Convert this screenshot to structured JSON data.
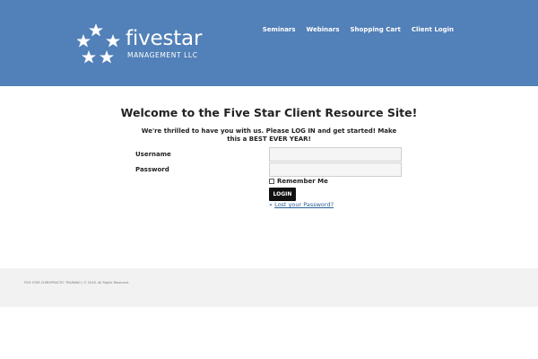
{
  "brand": {
    "name": "fivestar",
    "subtitle": "MANAGEMENT LLC",
    "star_color": "#ffffff"
  },
  "colors": {
    "header_bg": "#5280b8",
    "footer_bg": "#f2f2f2",
    "button_bg": "#111111",
    "link": "#2a5f97"
  },
  "nav": {
    "items": [
      {
        "label": "Seminars"
      },
      {
        "label": "Webinars"
      },
      {
        "label": "Shopping Cart"
      },
      {
        "label": "Client Login"
      }
    ]
  },
  "main": {
    "title": "Welcome to the Five Star Client Resource Site!",
    "intro": "We're thrilled to have you with us. Please LOG IN and get started! Make this a BEST EVER YEAR!"
  },
  "login_form": {
    "username_label": "Username",
    "username_value": "",
    "password_label": "Password",
    "password_value": "",
    "remember_label": "Remember Me",
    "remember_checked": false,
    "submit_label": "LOGIN",
    "lost_prefix": "»",
    "lost_password_label": "Lost your Password?"
  },
  "footer": {
    "company": "FIVE STAR CHIROPRACTIC TRAINING",
    "separator": "|",
    "copyright": "© 2016. All Rights Reserved."
  }
}
